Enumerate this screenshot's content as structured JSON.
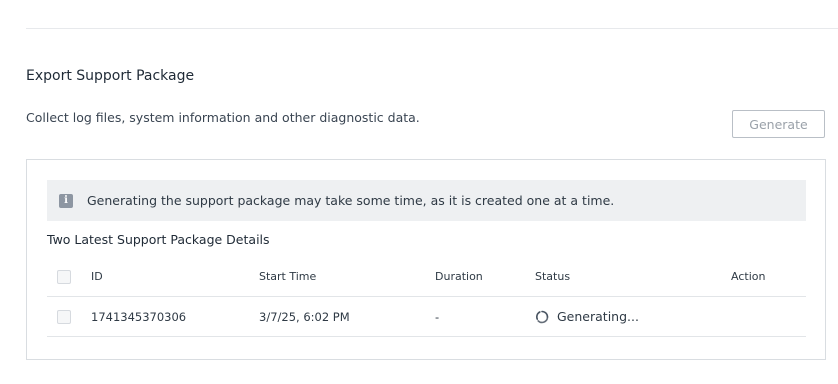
{
  "section": {
    "title": "Export Support Package",
    "description": "Collect log files, system information and other diagnostic data.",
    "generate_label": "Generate"
  },
  "notice": {
    "icon": "info-icon",
    "text": "Generating the support package may take some time, as it is created one at a time."
  },
  "table": {
    "heading": "Two Latest Support Package Details",
    "columns": {
      "id": "ID",
      "start_time": "Start Time",
      "duration": "Duration",
      "status": "Status",
      "action": "Action"
    },
    "rows": [
      {
        "id": "1741345370306",
        "start_time": "3/7/25, 6:02 PM",
        "duration": "-",
        "status": "Generating...",
        "status_icon": "spinner-icon",
        "action": ""
      }
    ]
  },
  "colors": {
    "accent_border": "#d9dde1",
    "notice_bg": "#eef0f2",
    "disabled_text": "#9aa1a9"
  }
}
